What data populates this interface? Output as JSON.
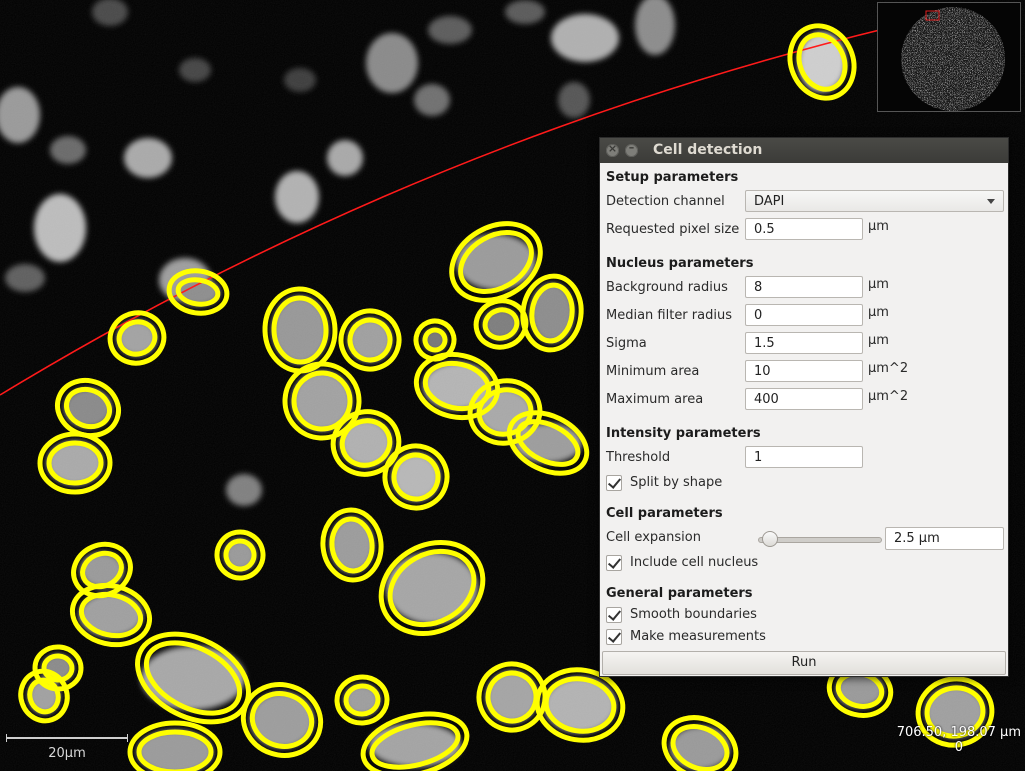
{
  "dialog": {
    "title": "Cell detection",
    "setup_header": "Setup parameters",
    "detection_channel_label": "Detection channel",
    "detection_channel_value": "DAPI",
    "pixel_size_label": "Requested pixel size",
    "pixel_size_value": "0.5",
    "pixel_size_unit": "µm",
    "nucleus_header": "Nucleus parameters",
    "background_radius_label": "Background radius",
    "background_radius_value": "8",
    "background_radius_unit": "µm",
    "median_filter_label": "Median filter radius",
    "median_filter_value": "0",
    "median_filter_unit": "µm",
    "sigma_label": "Sigma",
    "sigma_value": "1.5",
    "sigma_unit": "µm",
    "min_area_label": "Minimum area",
    "min_area_value": "10",
    "min_area_unit": "µm^2",
    "max_area_label": "Maximum area",
    "max_area_value": "400",
    "max_area_unit": "µm^2",
    "intensity_header": "Intensity parameters",
    "threshold_label": "Threshold",
    "threshold_value": "1",
    "split_by_shape_label": "Split by shape",
    "split_by_shape_checked": true,
    "cell_header": "Cell parameters",
    "cell_expansion_label": "Cell expansion",
    "cell_expansion_value": "2.5 µm",
    "cell_expansion_slider_fraction": 0.05,
    "include_nucleus_label": "Include cell nucleus",
    "include_nucleus_checked": true,
    "general_header": "General parameters",
    "smooth_boundaries_label": "Smooth boundaries",
    "smooth_boundaries_checked": true,
    "make_measurements_label": "Make measurements",
    "make_measurements_checked": true,
    "run_label": "Run"
  },
  "viewer": {
    "scalebar_label": "20µm",
    "cursor_position": "706.50, 198.07 µm",
    "cursor_value": "0",
    "outline_color": "#ffff00",
    "annotation_color": "#ff2020"
  }
}
